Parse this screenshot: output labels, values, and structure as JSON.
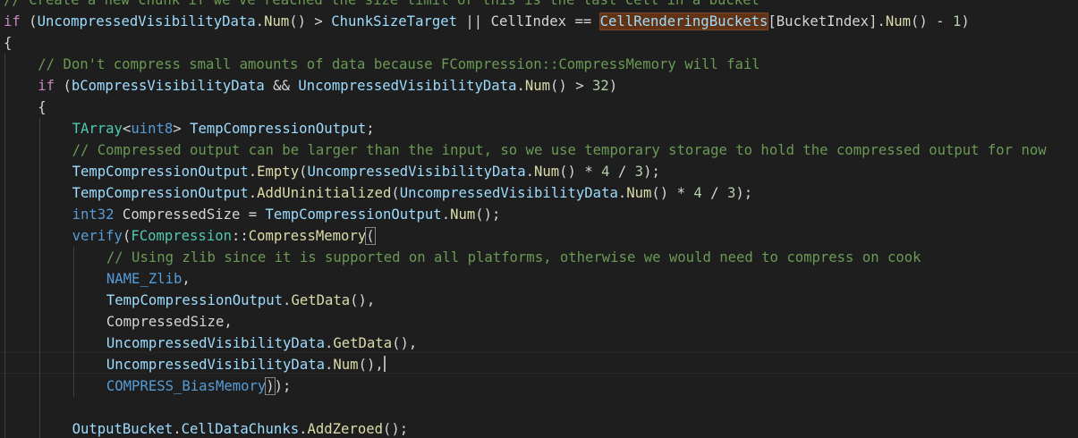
{
  "editor": {
    "lines": [
      {
        "row": 0,
        "indent": 0,
        "tokens": [
          {
            "cls": "c",
            "text": "// Create a new chunk if we've reached the size limit or this is the last cell in a bucket"
          }
        ]
      },
      {
        "row": 1,
        "indent": 0,
        "tokens": [
          {
            "cls": "ctrl",
            "text": "if"
          },
          {
            "cls": "p",
            "text": " ("
          },
          {
            "cls": "v",
            "text": "UncompressedVisibilityData"
          },
          {
            "cls": "p",
            "text": "."
          },
          {
            "cls": "f",
            "text": "Num"
          },
          {
            "cls": "p",
            "text": "() > "
          },
          {
            "cls": "v",
            "text": "ChunkSizeTarget"
          },
          {
            "cls": "p",
            "text": " || "
          },
          {
            "cls": "p",
            "text": "CellIndex"
          },
          {
            "cls": "p",
            "text": " == "
          },
          {
            "cls": "v hl",
            "text": "CellRenderingBuckets"
          },
          {
            "cls": "p",
            "text": "[BucketIndex]."
          },
          {
            "cls": "f",
            "text": "Num"
          },
          {
            "cls": "p",
            "text": "() - "
          },
          {
            "cls": "n",
            "text": "1"
          },
          {
            "cls": "p",
            "text": ")"
          }
        ]
      },
      {
        "row": 2,
        "indent": 0,
        "tokens": [
          {
            "cls": "p",
            "text": "{"
          }
        ]
      },
      {
        "row": 3,
        "indent": 1,
        "tokens": [
          {
            "cls": "c",
            "text": "// Don't compress small amounts of data because FCompression::CompressMemory will fail"
          }
        ]
      },
      {
        "row": 4,
        "indent": 1,
        "tokens": [
          {
            "cls": "ctrl",
            "text": "if"
          },
          {
            "cls": "p",
            "text": " ("
          },
          {
            "cls": "v",
            "text": "bCompressVisibilityData"
          },
          {
            "cls": "p",
            "text": " && "
          },
          {
            "cls": "v",
            "text": "UncompressedVisibilityData"
          },
          {
            "cls": "p",
            "text": "."
          },
          {
            "cls": "f",
            "text": "Num"
          },
          {
            "cls": "p",
            "text": "() > "
          },
          {
            "cls": "n",
            "text": "32"
          },
          {
            "cls": "p",
            "text": ")"
          }
        ]
      },
      {
        "row": 5,
        "indent": 1,
        "tokens": [
          {
            "cls": "p",
            "text": "{"
          }
        ]
      },
      {
        "row": 6,
        "indent": 2,
        "tokens": [
          {
            "cls": "t",
            "text": "TArray"
          },
          {
            "cls": "p",
            "text": "<"
          },
          {
            "cls": "k",
            "text": "uint8"
          },
          {
            "cls": "p",
            "text": "> "
          },
          {
            "cls": "v",
            "text": "TempCompressionOutput"
          },
          {
            "cls": "p",
            "text": ";"
          }
        ]
      },
      {
        "row": 7,
        "indent": 2,
        "tokens": [
          {
            "cls": "c",
            "text": "// Compressed output can be larger than the input, so we use temporary storage to hold the compressed output for now"
          }
        ]
      },
      {
        "row": 8,
        "indent": 2,
        "tokens": [
          {
            "cls": "v",
            "text": "TempCompressionOutput"
          },
          {
            "cls": "p",
            "text": "."
          },
          {
            "cls": "f",
            "text": "Empty"
          },
          {
            "cls": "p",
            "text": "("
          },
          {
            "cls": "v",
            "text": "UncompressedVisibilityData"
          },
          {
            "cls": "p",
            "text": "."
          },
          {
            "cls": "f",
            "text": "Num"
          },
          {
            "cls": "p",
            "text": "() * "
          },
          {
            "cls": "n",
            "text": "4"
          },
          {
            "cls": "p",
            "text": " / "
          },
          {
            "cls": "n",
            "text": "3"
          },
          {
            "cls": "p",
            "text": ");"
          }
        ]
      },
      {
        "row": 9,
        "indent": 2,
        "tokens": [
          {
            "cls": "v",
            "text": "TempCompressionOutput"
          },
          {
            "cls": "p",
            "text": "."
          },
          {
            "cls": "f",
            "text": "AddUninitialized"
          },
          {
            "cls": "p",
            "text": "("
          },
          {
            "cls": "v",
            "text": "UncompressedVisibilityData"
          },
          {
            "cls": "p",
            "text": "."
          },
          {
            "cls": "f",
            "text": "Num"
          },
          {
            "cls": "p",
            "text": "() * "
          },
          {
            "cls": "n",
            "text": "4"
          },
          {
            "cls": "p",
            "text": " / "
          },
          {
            "cls": "n",
            "text": "3"
          },
          {
            "cls": "p",
            "text": ");"
          }
        ]
      },
      {
        "row": 10,
        "indent": 2,
        "tokens": [
          {
            "cls": "k",
            "text": "int32"
          },
          {
            "cls": "p",
            "text": " CompressedSize = "
          },
          {
            "cls": "v",
            "text": "TempCompressionOutput"
          },
          {
            "cls": "p",
            "text": "."
          },
          {
            "cls": "f",
            "text": "Num"
          },
          {
            "cls": "p",
            "text": "();"
          }
        ]
      },
      {
        "row": 11,
        "indent": 2,
        "tokens": [
          {
            "cls": "k",
            "text": "verify"
          },
          {
            "cls": "p",
            "text": "("
          },
          {
            "cls": "t",
            "text": "FCompression"
          },
          {
            "cls": "p",
            "text": "::"
          },
          {
            "cls": "f",
            "text": "CompressMemory"
          },
          {
            "cls": "p br",
            "text": "("
          }
        ]
      },
      {
        "row": 12,
        "indent": 3,
        "tokens": [
          {
            "cls": "c",
            "text": "// Using zlib since it is supported on all platforms, otherwise we would need to compress on cook"
          }
        ]
      },
      {
        "row": 13,
        "indent": 3,
        "tokens": [
          {
            "cls": "k",
            "text": "NAME_Zlib"
          },
          {
            "cls": "p",
            "text": ","
          }
        ]
      },
      {
        "row": 14,
        "indent": 3,
        "tokens": [
          {
            "cls": "v",
            "text": "TempCompressionOutput"
          },
          {
            "cls": "p",
            "text": "."
          },
          {
            "cls": "f",
            "text": "GetData"
          },
          {
            "cls": "p",
            "text": "(),"
          }
        ]
      },
      {
        "row": 15,
        "indent": 3,
        "tokens": [
          {
            "cls": "p",
            "text": "CompressedSize,"
          }
        ]
      },
      {
        "row": 16,
        "indent": 3,
        "tokens": [
          {
            "cls": "v",
            "text": "UncompressedVisibilityData"
          },
          {
            "cls": "p",
            "text": "."
          },
          {
            "cls": "f",
            "text": "GetData"
          },
          {
            "cls": "p",
            "text": "(),"
          }
        ]
      },
      {
        "row": 17,
        "indent": 3,
        "tokens": [
          {
            "cls": "v",
            "text": "UncompressedVisibilityData"
          },
          {
            "cls": "p",
            "text": "."
          },
          {
            "cls": "f",
            "text": "Num"
          },
          {
            "cls": "p",
            "text": "(),"
          }
        ]
      },
      {
        "row": 18,
        "indent": 3,
        "tokens": [
          {
            "cls": "k",
            "text": "COMPRESS_BiasMemory"
          },
          {
            "cls": "p br",
            "text": ")"
          },
          {
            "cls": "p",
            "text": ");"
          }
        ]
      },
      {
        "row": 20,
        "indent": 2,
        "tokens": [
          {
            "cls": "v",
            "text": "OutputBucket"
          },
          {
            "cls": "p",
            "text": "."
          },
          {
            "cls": "v",
            "text": "CellDataChunks"
          },
          {
            "cls": "p",
            "text": "."
          },
          {
            "cls": "f",
            "text": "AddZeroed"
          },
          {
            "cls": "p",
            "text": "();"
          }
        ]
      }
    ]
  }
}
